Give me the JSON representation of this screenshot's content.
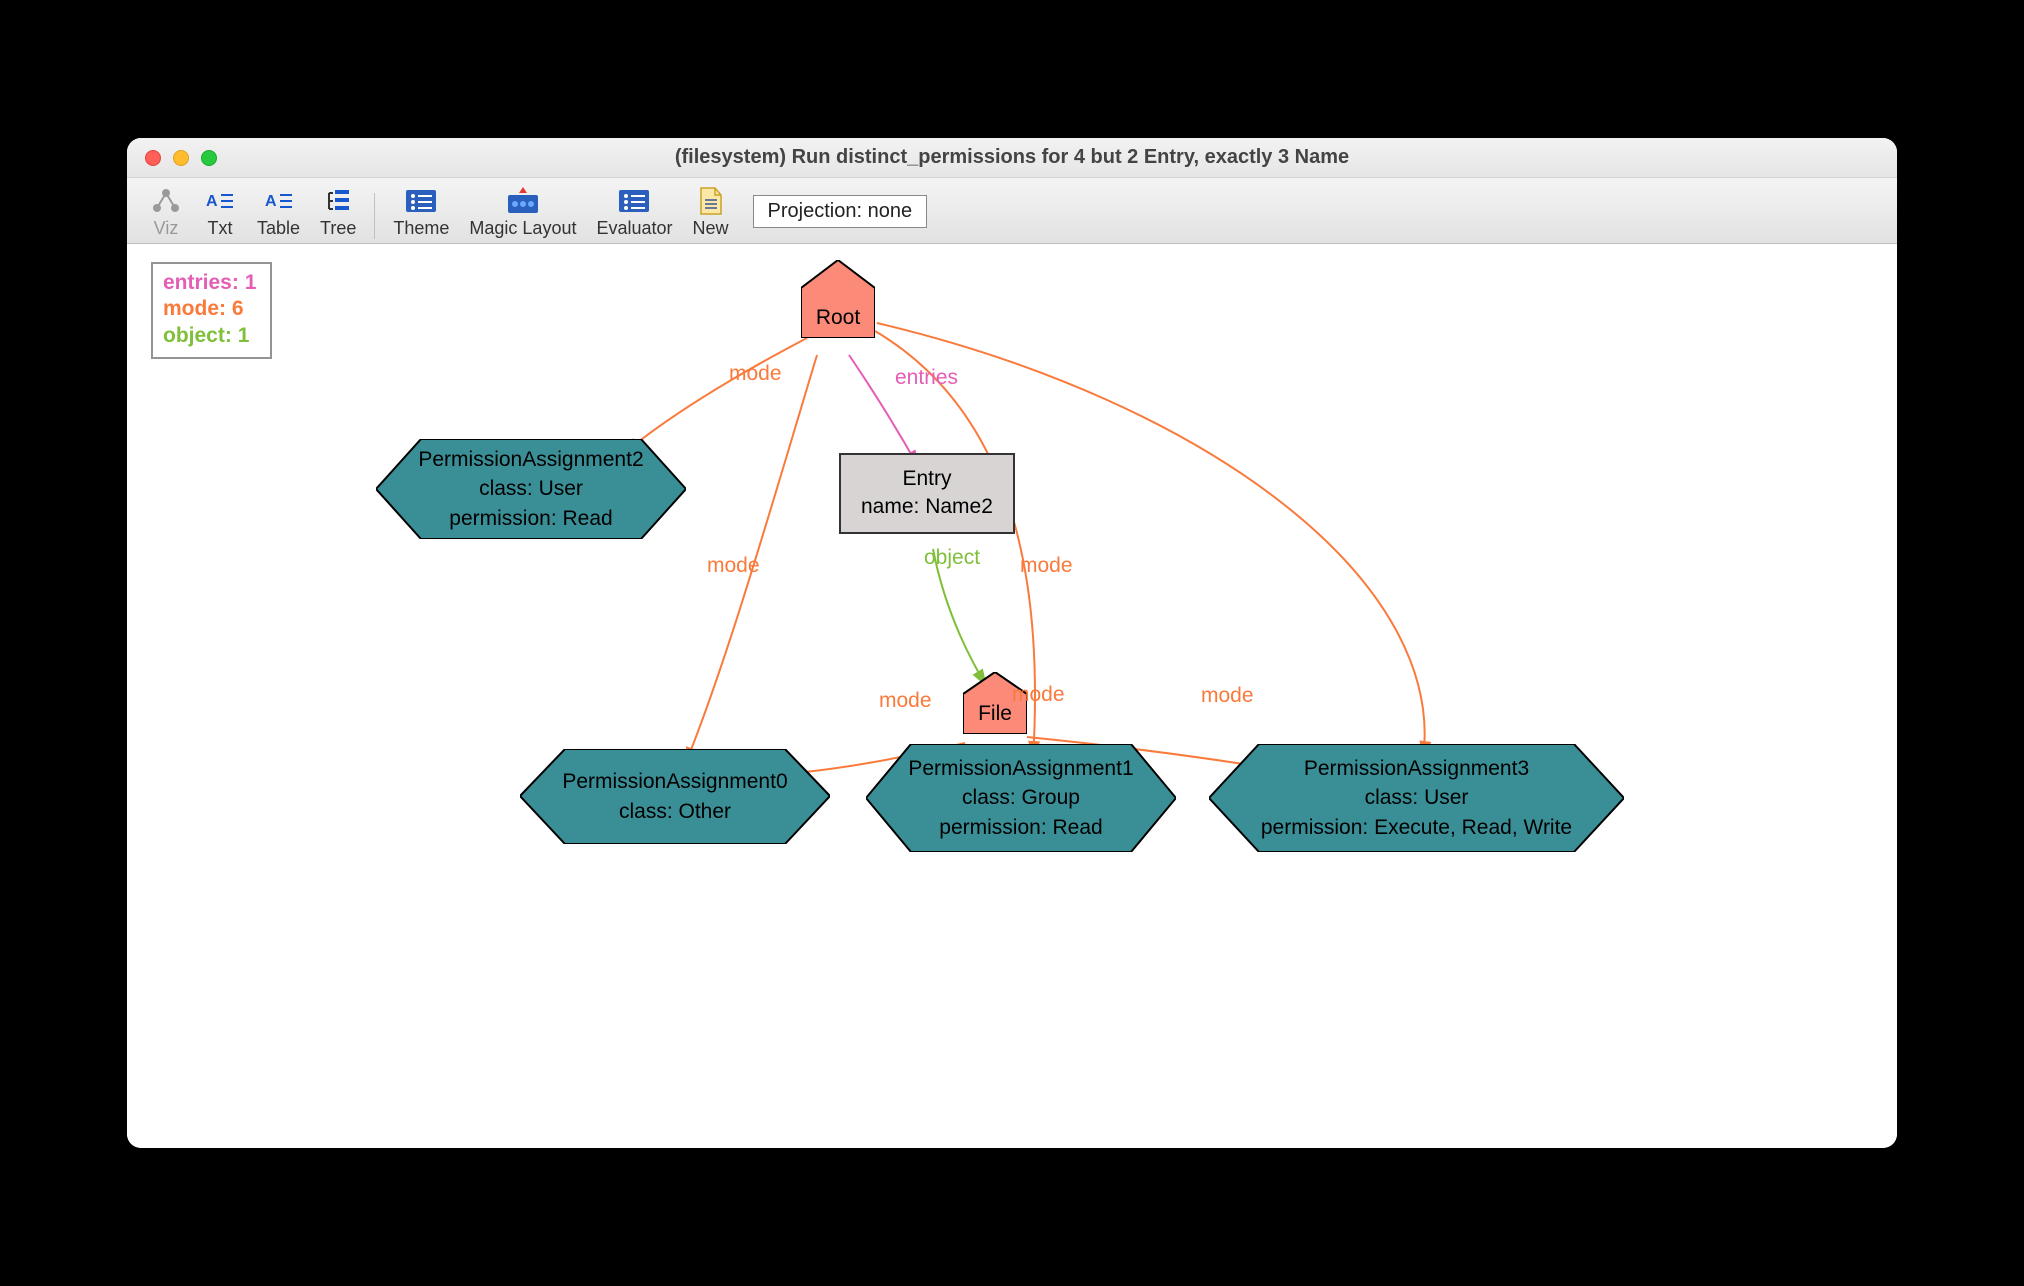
{
  "window": {
    "title": "(filesystem) Run distinct_permissions for 4 but 2 Entry, exactly 3 Name"
  },
  "toolbar": {
    "viz": "Viz",
    "txt": "Txt",
    "table": "Table",
    "tree": "Tree",
    "theme": "Theme",
    "magic_layout": "Magic Layout",
    "evaluator": "Evaluator",
    "new": "New",
    "projection": "Projection: none"
  },
  "legend": {
    "entries": {
      "label": "entries:",
      "value": "1"
    },
    "mode": {
      "label": "mode:",
      "value": "6"
    },
    "object": {
      "label": "object:",
      "value": "1"
    }
  },
  "nodes": {
    "root": {
      "label": "Root"
    },
    "file": {
      "label": "File"
    },
    "entry": {
      "line1": "Entry",
      "line2": "name: Name2"
    },
    "pa0": {
      "line1": "PermissionAssignment0",
      "line2": "class: Other"
    },
    "pa1": {
      "line1": "PermissionAssignment1",
      "line2": "class: Group",
      "line3": "permission: Read"
    },
    "pa2": {
      "line1": "PermissionAssignment2",
      "line2": "class: User",
      "line3": "permission: Read"
    },
    "pa3": {
      "line1": "PermissionAssignment3",
      "line2": "class: User",
      "line3": "permission: Execute, Read, Write"
    }
  },
  "edges": {
    "mode": "mode",
    "entries": "entries",
    "object": "object"
  }
}
